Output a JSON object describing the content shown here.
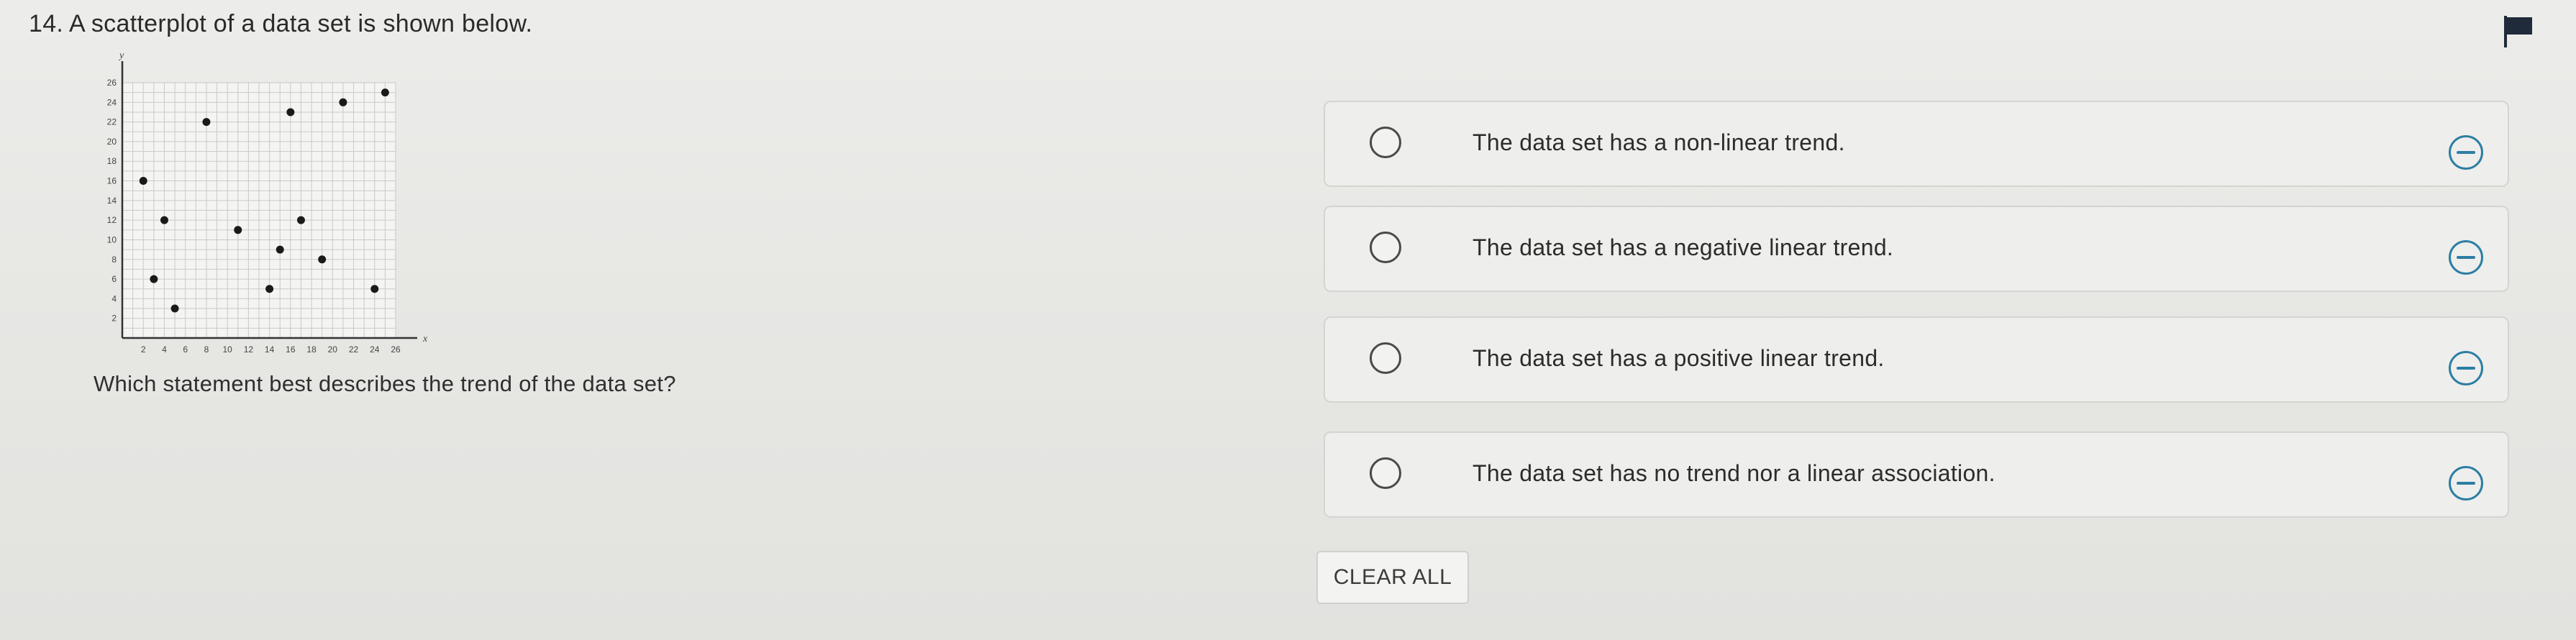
{
  "question": {
    "title": "14. A scatterplot of a data set is shown below.",
    "prompt": "Which statement best describes the trend of the data set?"
  },
  "flag": {
    "icon": "flag-icon"
  },
  "choices": [
    {
      "label": "The data set has a non-linear trend."
    },
    {
      "label": "The data set has a negative linear trend."
    },
    {
      "label": "The data set has a positive linear trend."
    },
    {
      "label": "The data set has no trend nor a linear association."
    }
  ],
  "eliminate_icon": "eliminate-icon",
  "clear_label": "CLEAR ALL",
  "colors": {
    "accent": "#2d7ea3",
    "point": "#1a1a1a"
  },
  "chart_data": {
    "type": "scatter",
    "xlabel": "x",
    "ylabel": "y",
    "xlim": [
      0,
      26
    ],
    "ylim": [
      0,
      26
    ],
    "x_ticks": [
      "2",
      "4",
      "6",
      "8",
      "10",
      "12",
      "14",
      "16",
      "18",
      "20",
      "22",
      "24",
      "26"
    ],
    "y_ticks": [
      "2",
      "4",
      "6",
      "8",
      "10",
      "12",
      "14",
      "16",
      "18",
      "20",
      "22",
      "24",
      "26"
    ],
    "grid": true,
    "points": [
      {
        "x": 2,
        "y": 16
      },
      {
        "x": 3,
        "y": 6
      },
      {
        "x": 4,
        "y": 12
      },
      {
        "x": 5,
        "y": 3
      },
      {
        "x": 8,
        "y": 22
      },
      {
        "x": 11,
        "y": 11
      },
      {
        "x": 14,
        "y": 5
      },
      {
        "x": 15,
        "y": 9
      },
      {
        "x": 16,
        "y": 23
      },
      {
        "x": 17,
        "y": 12
      },
      {
        "x": 19,
        "y": 8
      },
      {
        "x": 21,
        "y": 24
      },
      {
        "x": 24,
        "y": 5
      },
      {
        "x": 25,
        "y": 25
      }
    ]
  }
}
